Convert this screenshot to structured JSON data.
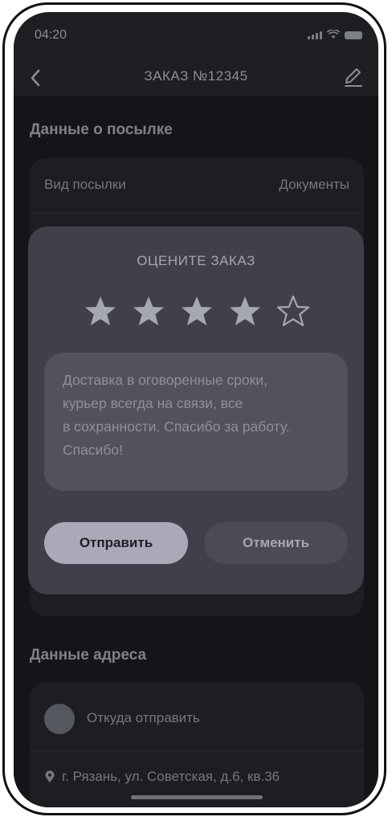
{
  "status_bar": {
    "time": "04:20"
  },
  "header": {
    "title": "ЗАКАЗ №12345"
  },
  "parcel_section": {
    "title": "Данные о посылке",
    "rows": [
      {
        "label": "Вид посылки",
        "value": "Документы"
      }
    ]
  },
  "address_section": {
    "title": "Данные адреса",
    "from_label": "Откуда отправить",
    "address": "г. Рязань, ул. Советская, д.6, кв.36"
  },
  "rating_dialog": {
    "title": "ОЦЕНИТЕ ЗАКАЗ",
    "rating": 4,
    "max_rating": 5,
    "comment": "Доставка в оговоренные сроки,\nкурьер всегда на связи, все\nв сохранности. Спасибо за работу.\nСпасибо!",
    "submit_label": "Отправить",
    "cancel_label": "Отменить"
  },
  "colors": {
    "background": "#141518",
    "card": "#1d1e22",
    "dialog": "#3f4049",
    "submit_button": "#a9a9b8",
    "cancel_button": "#4a4b55"
  },
  "icons": [
    "back-chevron-icon",
    "edit-pencil-icon",
    "star-icon",
    "location-pin-icon",
    "signal-icon",
    "wifi-icon",
    "battery-icon"
  ]
}
